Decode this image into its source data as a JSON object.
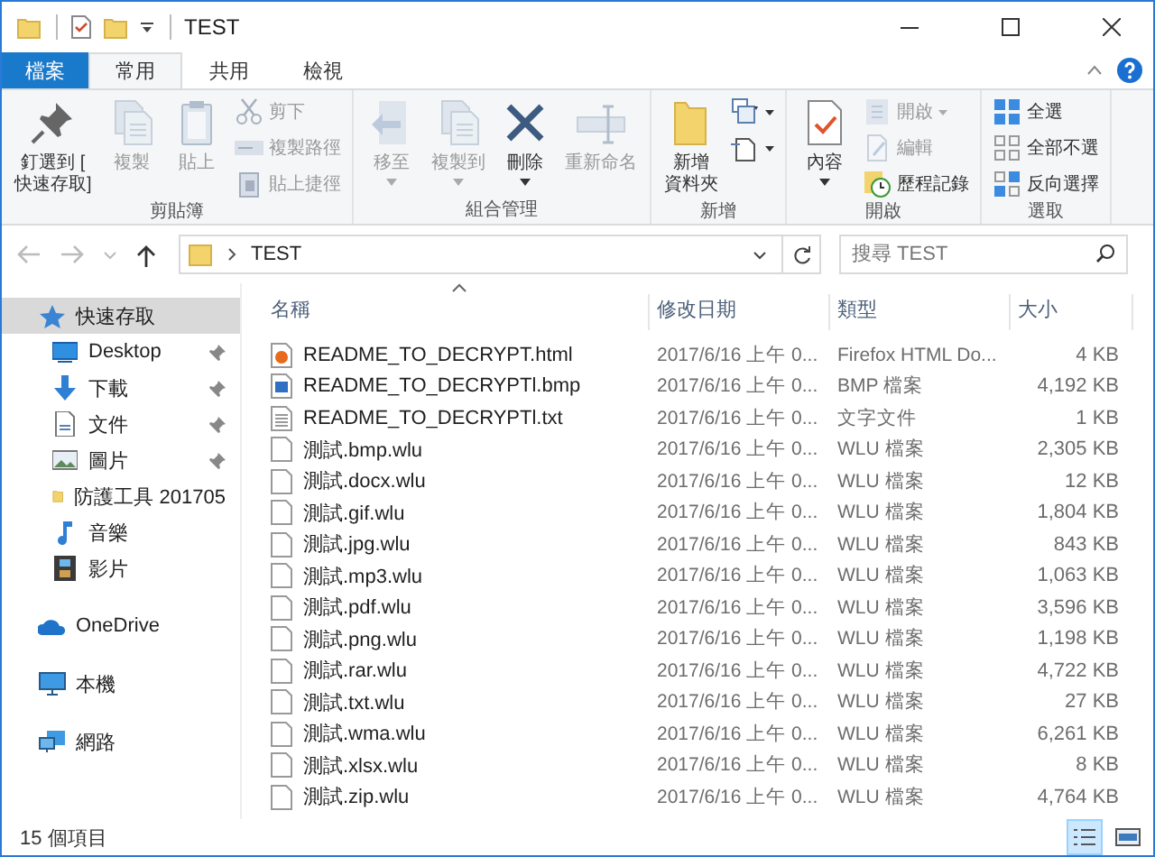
{
  "window": {
    "title": "TEST"
  },
  "file_tab": "檔案",
  "tabs": [
    {
      "label": "常用",
      "selected": true
    },
    {
      "label": "共用",
      "selected": false
    },
    {
      "label": "檢視",
      "selected": false
    }
  ],
  "ribbon": [
    {
      "label": "剪貼簿",
      "items": [
        {
          "kind": "large",
          "label": "釘選到 [\n快速存取]",
          "disabled": false,
          "dropdown": false
        },
        {
          "kind": "large",
          "label": "複製",
          "disabled": true,
          "dropdown": false
        },
        {
          "kind": "large",
          "label": "貼上",
          "disabled": true,
          "dropdown": false
        },
        {
          "kind": "stack",
          "items": [
            {
              "label": "剪下",
              "disabled": true,
              "dropdown": false
            },
            {
              "label": "複製路徑",
              "disabled": true,
              "dropdown": false
            },
            {
              "label": "貼上捷徑",
              "disabled": true,
              "dropdown": false
            }
          ]
        }
      ]
    },
    {
      "label": "組合管理",
      "items": [
        {
          "kind": "large",
          "label": "移至",
          "disabled": true,
          "dropdown": true
        },
        {
          "kind": "large",
          "label": "複製到",
          "disabled": true,
          "dropdown": true
        },
        {
          "kind": "large",
          "label": "刪除",
          "disabled": false,
          "dropdown": true
        },
        {
          "kind": "large",
          "label": "重新命名",
          "disabled": true,
          "dropdown": false
        }
      ]
    },
    {
      "label": "新增",
      "items": [
        {
          "kind": "large",
          "lines": [
            "新增",
            "資料夾"
          ],
          "disabled": false,
          "dropdown": false
        },
        {
          "kind": "stack",
          "items": [
            {
              "disabled": false,
              "dropdown": true
            },
            {
              "disabled": false,
              "dropdown": true
            }
          ]
        }
      ]
    },
    {
      "label": "開啟",
      "items": [
        {
          "kind": "large",
          "label": "內容",
          "disabled": false,
          "dropdown": true
        },
        {
          "kind": "stack",
          "items": [
            {
              "label": "開啟",
              "disabled": true,
              "dropdown": true
            },
            {
              "label": "編輯",
              "disabled": true,
              "dropdown": false
            },
            {
              "label": "歷程記錄",
              "disabled": false,
              "dropdown": false
            }
          ]
        }
      ]
    },
    {
      "label": "選取",
      "items": [
        {
          "kind": "stack",
          "items": [
            {
              "label": "全選",
              "disabled": false,
              "dropdown": false
            },
            {
              "label": "全部不選",
              "disabled": false,
              "dropdown": false
            },
            {
              "label": "反向選擇",
              "disabled": false,
              "dropdown": false
            }
          ]
        }
      ]
    }
  ],
  "address": {
    "path": "TEST"
  },
  "search": {
    "placeholder": "搜尋 TEST"
  },
  "sidebar": {
    "items": [
      {
        "label": "快速存取",
        "selected": true,
        "children": [
          {
            "label": "Desktop",
            "pinned": true
          },
          {
            "label": "下載",
            "pinned": true
          },
          {
            "label": "文件",
            "pinned": true
          },
          {
            "label": "圖片",
            "pinned": true
          },
          {
            "label": "防護工具 201705",
            "pinned": false
          },
          {
            "label": "音樂",
            "pinned": false
          },
          {
            "label": "影片",
            "pinned": false
          }
        ]
      },
      {
        "label": "OneDrive",
        "selected": false
      },
      {
        "label": "本機",
        "selected": false
      },
      {
        "label": "網路",
        "selected": false
      }
    ]
  },
  "table": {
    "columns": [
      "名稱",
      "修改日期",
      "類型",
      "大小"
    ],
    "rows": [
      {
        "kind": "html",
        "name": "README_TO_DECRYPT.html",
        "date": "2017/6/16 上午 0...",
        "type": "Firefox HTML Do...",
        "size": "4 KB"
      },
      {
        "kind": "bmp",
        "name": "README_TO_DECRYPTl.bmp",
        "date": "2017/6/16 上午 0...",
        "type": "BMP 檔案",
        "size": "4,192 KB"
      },
      {
        "kind": "txt",
        "name": "README_TO_DECRYPTl.txt",
        "date": "2017/6/16 上午 0...",
        "type": "文字文件",
        "size": "1 KB"
      },
      {
        "kind": "blank",
        "name": "測試.bmp.wlu",
        "date": "2017/6/16 上午 0...",
        "type": "WLU 檔案",
        "size": "2,305 KB"
      },
      {
        "kind": "blank",
        "name": "測試.docx.wlu",
        "date": "2017/6/16 上午 0...",
        "type": "WLU 檔案",
        "size": "12 KB"
      },
      {
        "kind": "blank",
        "name": "測試.gif.wlu",
        "date": "2017/6/16 上午 0...",
        "type": "WLU 檔案",
        "size": "1,804 KB"
      },
      {
        "kind": "blank",
        "name": "測試.jpg.wlu",
        "date": "2017/6/16 上午 0...",
        "type": "WLU 檔案",
        "size": "843 KB"
      },
      {
        "kind": "blank",
        "name": "測試.mp3.wlu",
        "date": "2017/6/16 上午 0...",
        "type": "WLU 檔案",
        "size": "1,063 KB"
      },
      {
        "kind": "blank",
        "name": "測試.pdf.wlu",
        "date": "2017/6/16 上午 0...",
        "type": "WLU 檔案",
        "size": "3,596 KB"
      },
      {
        "kind": "blank",
        "name": "測試.png.wlu",
        "date": "2017/6/16 上午 0...",
        "type": "WLU 檔案",
        "size": "1,198 KB"
      },
      {
        "kind": "blank",
        "name": "測試.rar.wlu",
        "date": "2017/6/16 上午 0...",
        "type": "WLU 檔案",
        "size": "4,722 KB"
      },
      {
        "kind": "blank",
        "name": "測試.txt.wlu",
        "date": "2017/6/16 上午 0...",
        "type": "WLU 檔案",
        "size": "27 KB"
      },
      {
        "kind": "blank",
        "name": "測試.wma.wlu",
        "date": "2017/6/16 上午 0...",
        "type": "WLU 檔案",
        "size": "6,261 KB"
      },
      {
        "kind": "blank",
        "name": "測試.xlsx.wlu",
        "date": "2017/6/16 上午 0...",
        "type": "WLU 檔案",
        "size": "8 KB"
      },
      {
        "kind": "blank",
        "name": "測試.zip.wlu",
        "date": "2017/6/16 上午 0...",
        "type": "WLU 檔案",
        "size": "4,764 KB"
      }
    ]
  },
  "status_bar": {
    "count": "15 個項目",
    "views": [
      {
        "selected": true
      },
      {
        "selected": false
      }
    ]
  }
}
